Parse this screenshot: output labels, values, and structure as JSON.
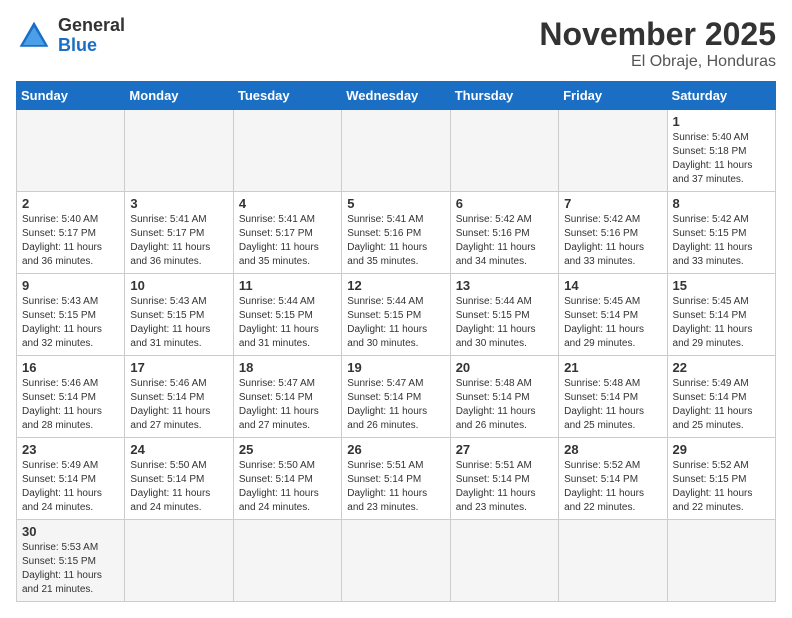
{
  "logo": {
    "text_general": "General",
    "text_blue": "Blue"
  },
  "header": {
    "month": "November 2025",
    "location": "El Obraje, Honduras"
  },
  "weekdays": [
    "Sunday",
    "Monday",
    "Tuesday",
    "Wednesday",
    "Thursday",
    "Friday",
    "Saturday"
  ],
  "days": [
    {
      "date": "",
      "info": ""
    },
    {
      "date": "",
      "info": ""
    },
    {
      "date": "",
      "info": ""
    },
    {
      "date": "",
      "info": ""
    },
    {
      "date": "",
      "info": ""
    },
    {
      "date": "",
      "info": ""
    },
    {
      "date": "1",
      "info": "Sunrise: 5:40 AM\nSunset: 5:18 PM\nDaylight: 11 hours\nand 37 minutes."
    },
    {
      "date": "2",
      "info": "Sunrise: 5:40 AM\nSunset: 5:17 PM\nDaylight: 11 hours\nand 36 minutes."
    },
    {
      "date": "3",
      "info": "Sunrise: 5:41 AM\nSunset: 5:17 PM\nDaylight: 11 hours\nand 36 minutes."
    },
    {
      "date": "4",
      "info": "Sunrise: 5:41 AM\nSunset: 5:17 PM\nDaylight: 11 hours\nand 35 minutes."
    },
    {
      "date": "5",
      "info": "Sunrise: 5:41 AM\nSunset: 5:16 PM\nDaylight: 11 hours\nand 35 minutes."
    },
    {
      "date": "6",
      "info": "Sunrise: 5:42 AM\nSunset: 5:16 PM\nDaylight: 11 hours\nand 34 minutes."
    },
    {
      "date": "7",
      "info": "Sunrise: 5:42 AM\nSunset: 5:16 PM\nDaylight: 11 hours\nand 33 minutes."
    },
    {
      "date": "8",
      "info": "Sunrise: 5:42 AM\nSunset: 5:15 PM\nDaylight: 11 hours\nand 33 minutes."
    },
    {
      "date": "9",
      "info": "Sunrise: 5:43 AM\nSunset: 5:15 PM\nDaylight: 11 hours\nand 32 minutes."
    },
    {
      "date": "10",
      "info": "Sunrise: 5:43 AM\nSunset: 5:15 PM\nDaylight: 11 hours\nand 31 minutes."
    },
    {
      "date": "11",
      "info": "Sunrise: 5:44 AM\nSunset: 5:15 PM\nDaylight: 11 hours\nand 31 minutes."
    },
    {
      "date": "12",
      "info": "Sunrise: 5:44 AM\nSunset: 5:15 PM\nDaylight: 11 hours\nand 30 minutes."
    },
    {
      "date": "13",
      "info": "Sunrise: 5:44 AM\nSunset: 5:15 PM\nDaylight: 11 hours\nand 30 minutes."
    },
    {
      "date": "14",
      "info": "Sunrise: 5:45 AM\nSunset: 5:14 PM\nDaylight: 11 hours\nand 29 minutes."
    },
    {
      "date": "15",
      "info": "Sunrise: 5:45 AM\nSunset: 5:14 PM\nDaylight: 11 hours\nand 29 minutes."
    },
    {
      "date": "16",
      "info": "Sunrise: 5:46 AM\nSunset: 5:14 PM\nDaylight: 11 hours\nand 28 minutes."
    },
    {
      "date": "17",
      "info": "Sunrise: 5:46 AM\nSunset: 5:14 PM\nDaylight: 11 hours\nand 27 minutes."
    },
    {
      "date": "18",
      "info": "Sunrise: 5:47 AM\nSunset: 5:14 PM\nDaylight: 11 hours\nand 27 minutes."
    },
    {
      "date": "19",
      "info": "Sunrise: 5:47 AM\nSunset: 5:14 PM\nDaylight: 11 hours\nand 26 minutes."
    },
    {
      "date": "20",
      "info": "Sunrise: 5:48 AM\nSunset: 5:14 PM\nDaylight: 11 hours\nand 26 minutes."
    },
    {
      "date": "21",
      "info": "Sunrise: 5:48 AM\nSunset: 5:14 PM\nDaylight: 11 hours\nand 25 minutes."
    },
    {
      "date": "22",
      "info": "Sunrise: 5:49 AM\nSunset: 5:14 PM\nDaylight: 11 hours\nand 25 minutes."
    },
    {
      "date": "23",
      "info": "Sunrise: 5:49 AM\nSunset: 5:14 PM\nDaylight: 11 hours\nand 24 minutes."
    },
    {
      "date": "24",
      "info": "Sunrise: 5:50 AM\nSunset: 5:14 PM\nDaylight: 11 hours\nand 24 minutes."
    },
    {
      "date": "25",
      "info": "Sunrise: 5:50 AM\nSunset: 5:14 PM\nDaylight: 11 hours\nand 24 minutes."
    },
    {
      "date": "26",
      "info": "Sunrise: 5:51 AM\nSunset: 5:14 PM\nDaylight: 11 hours\nand 23 minutes."
    },
    {
      "date": "27",
      "info": "Sunrise: 5:51 AM\nSunset: 5:14 PM\nDaylight: 11 hours\nand 23 minutes."
    },
    {
      "date": "28",
      "info": "Sunrise: 5:52 AM\nSunset: 5:14 PM\nDaylight: 11 hours\nand 22 minutes."
    },
    {
      "date": "29",
      "info": "Sunrise: 5:52 AM\nSunset: 5:15 PM\nDaylight: 11 hours\nand 22 minutes."
    },
    {
      "date": "30",
      "info": "Sunrise: 5:53 AM\nSunset: 5:15 PM\nDaylight: 11 hours\nand 21 minutes."
    },
    {
      "date": "",
      "info": ""
    },
    {
      "date": "",
      "info": ""
    },
    {
      "date": "",
      "info": ""
    },
    {
      "date": "",
      "info": ""
    },
    {
      "date": "",
      "info": ""
    },
    {
      "date": "",
      "info": ""
    }
  ]
}
